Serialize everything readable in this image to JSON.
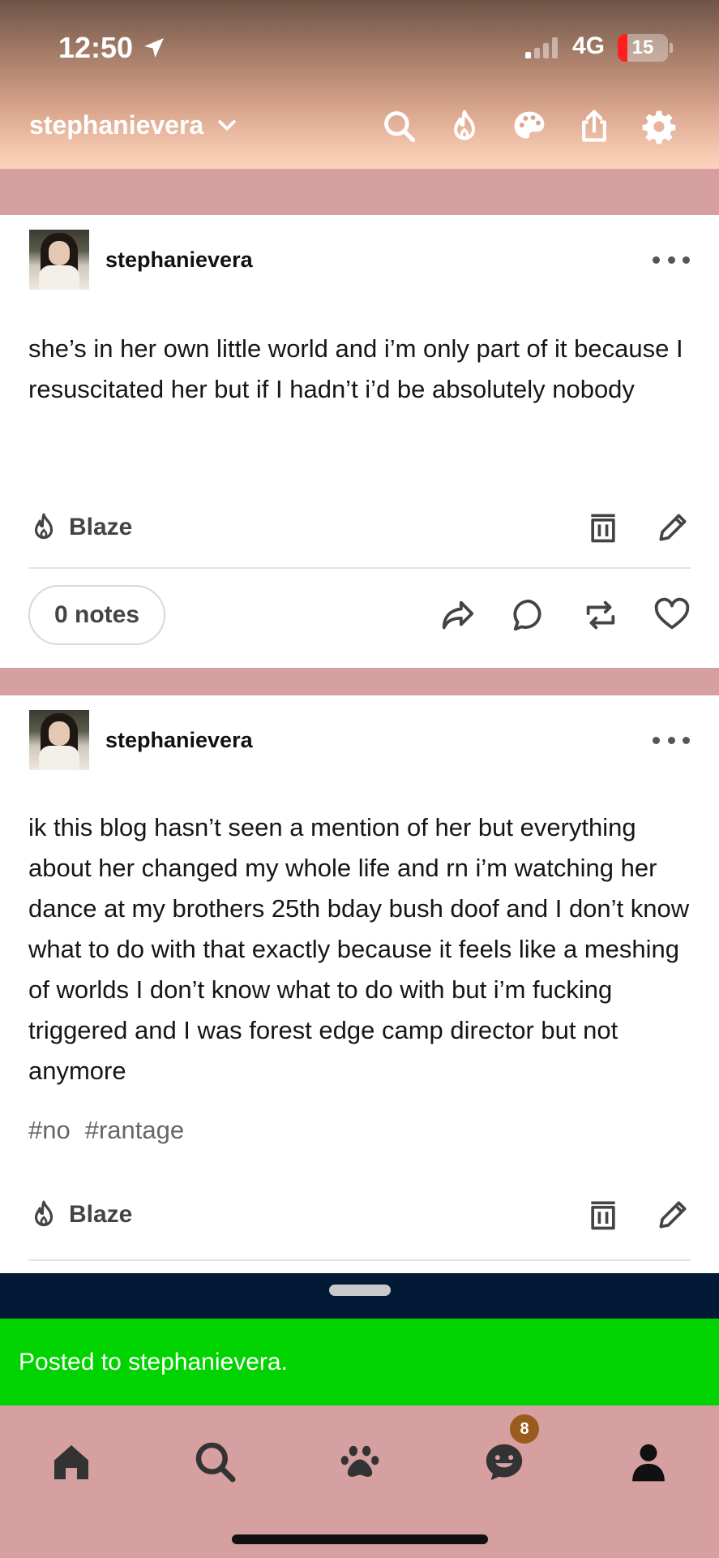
{
  "status_bar": {
    "time": "12:50",
    "network": "4G",
    "battery": "15"
  },
  "header": {
    "blog_name": "stephanievera",
    "icons": [
      "search-icon",
      "flame-icon",
      "palette-icon",
      "share-icon",
      "settings-icon"
    ]
  },
  "posts": [
    {
      "username": "stephanievera",
      "body": "she’s in her own little world and i’m only part of it because I resuscitated her but if I hadn’t i’d be absolutely nobody",
      "blaze_label": "Blaze",
      "notes_label": "0 notes"
    },
    {
      "username": "stephanievera",
      "body": "ik this blog hasn’t seen a mention of her but everything about her changed my whole life and rn i’m watching her dance at my brothers 25th bday bush doof and I don’t know what to do with that exactly because it feels like a meshing of worlds I don’t know what to do with but i’m fucking triggered and I was forest edge camp director but not anymore",
      "tags": [
        "#no",
        "#rantage"
      ],
      "blaze_label": "Blaze"
    }
  ],
  "toast": {
    "message": "Posted to stephanievera."
  },
  "tabbar": {
    "items": [
      "home-icon",
      "search-icon",
      "communities-icon",
      "activity-icon",
      "account-icon"
    ],
    "activity_badge": "8"
  },
  "colors": {
    "page_bg": "#d6a0a0",
    "toast_green": "#00d300",
    "sheet_navy": "#031a36",
    "badge": "#9a5c1e"
  }
}
